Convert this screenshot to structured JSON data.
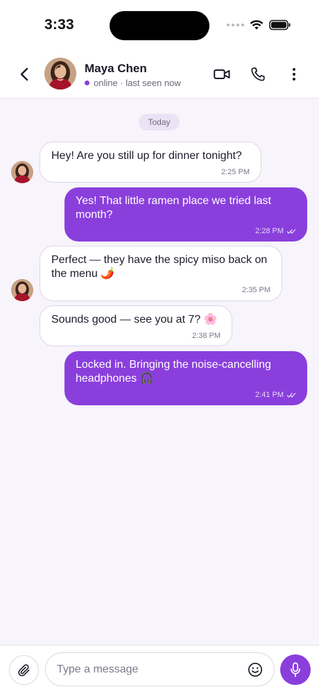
{
  "status_bar": {
    "time": "3:33"
  },
  "header": {
    "contact_name": "Maya Chen",
    "status_text": "online · last seen now"
  },
  "chat": {
    "date_divider": "Today",
    "messages": [
      {
        "direction": "incoming",
        "text": "Hey! Are you still up for dinner tonight?",
        "time": "2:25 PM"
      },
      {
        "direction": "outgoing",
        "text": "Yes! That little ramen place we tried last month?",
        "time": "2:28 PM",
        "read": true
      },
      {
        "direction": "incoming",
        "text": "Perfect — they have the spicy miso back on the menu 🌶️",
        "time": "2:35 PM"
      },
      {
        "direction": "incoming",
        "text": "Sounds good — see you at 7? 🌸",
        "time": "2:38 PM"
      },
      {
        "direction": "outgoing",
        "text": "Locked in. Bringing the noise-cancelling headphones 🎧",
        "time": "2:41 PM",
        "read": true
      }
    ]
  },
  "composer": {
    "placeholder": "Type a message"
  },
  "colors": {
    "accent": "#8a3fdc",
    "background": "#f7f4fb",
    "incoming_bubble": "#ffffff"
  },
  "icons": {
    "back": "chevron-left-icon",
    "video": "video-camera-icon",
    "call": "phone-icon",
    "more": "more-vertical-icon",
    "attach": "paperclip-icon",
    "emoji": "smiley-icon",
    "mic": "microphone-icon",
    "read_receipt": "double-check-icon"
  }
}
